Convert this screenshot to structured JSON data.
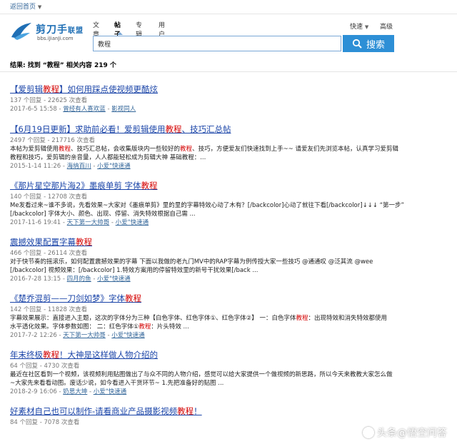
{
  "topbar": {
    "back_link": "返回首页"
  },
  "logo": {
    "name": "剪刀手",
    "brand": "联盟",
    "domain": "bbs.iJianJi.com"
  },
  "tabs": [
    "文章",
    "帖子",
    "专辑",
    "用户"
  ],
  "right_links": {
    "quick": "快速",
    "advanced": "高级"
  },
  "search": {
    "value": "教程",
    "button": "搜索"
  },
  "summary": {
    "prefix": "结果: 找到 “",
    "keyword": "教程",
    "suffix": "” 相关内容 219 个"
  },
  "results": [
    {
      "title_a": "【爱剪辑",
      "title_hl": "教程",
      "title_b": "】如何用踩点使视频更酷炫",
      "meta": "137 个回复 - 22625 次查看",
      "summary_html": "",
      "info_date": "2017-6-5 15:58",
      "info_author": "曾经有人喜欢蓝",
      "info_forum": "影视同人"
    },
    {
      "title_a": "【6月19日更新】求助前必看！爱剪辑使用",
      "title_hl": "教程",
      "title_b": "、技巧汇总帖",
      "meta": "2497 个回复 - 217716 次查看",
      "summary_a": "本帖为爱剪辑使用",
      "summary_hl1": "教程",
      "summary_b": "、技巧汇总帖，会收集版块内一些较好的",
      "summary_hl2": "教程",
      "summary_c": "、技巧，方便爱友们快速找到上手~~ 请爱友们先浏览本帖，认真学习爱剪辑",
      "summary_line2": "教程和技巧，爱剪辑的亲音量，人人都能轻松成为剪辑大神 基础教程：...",
      "info_date": "2015-1-14 11:26",
      "info_author": "海纳百川",
      "info_forum": "小爱\"快速通"
    },
    {
      "title_a": "《那片星空那片海2》墨痕单剪 字体",
      "title_hl": "教程",
      "title_b": "",
      "meta": "140 个回复 - 12708 次查看",
      "summary_a": "Me发看过来~谁不多说，先看效果~大家对《墨痕单剪》里的里的字幕特效心动了木有？[/backcolor]心动了就往下看[/backcolor]↓↓↓ “第一步”",
      "summary_line2": "[/backcolor] 字体大小、颜色、出现、停留、消失特效根据自己需 ...",
      "info_date": "2017-11-6 19:41",
      "info_author": "天下第一大帅哥",
      "info_forum": "小爱\"快速通"
    },
    {
      "title_a": "震撼效果配置字幕",
      "title_hl": "教程",
      "title_b": "",
      "meta": "466 个回复 - 26114 次查看",
      "summary_a": "对于快节奏的摇滚乐，如何配置震撼效果的字幕 下面以我做的老九门MV中的RAP字幕为例传授大家一些技巧 @通通叹 @泛其流 @wee",
      "summary_line2": "[/backcolor] 视频效果：[/backcolor] 1.特效方案用的停留特效里的新号干扰效果[/back ...",
      "info_date": "2016-7-28 13:15",
      "info_author": "四月的鱼",
      "info_forum": "小爱\"快速通"
    },
    {
      "title_a": "《楚乔混剪——刀剑如梦》字体",
      "title_hl": "教程",
      "title_b": "",
      "meta": "142 个回复 - 11828 次查看",
      "summary_a": "字幕效果展示：直接进入主题，这次的字体分为三种【白色字体、红色字体①、红色字体②】 一：白色字体",
      "summary_hl1": "教程",
      "summary_b": "：出现特效和消失特效都使用",
      "summary_line2": "水平透化效果。字体参数如图： 二：红色字体①",
      "summary_hl3": "教程",
      "summary_line2b": "：片头特效 ...",
      "info_date": "2017-7-2 12:26",
      "info_author": "天下第一大帅哥",
      "info_forum": "小爱\"快速通"
    },
    {
      "title_a": "年末终极",
      "title_hl": "教程",
      "title_b": "！大神是这样做人物介绍的",
      "meta": "64 个回复 - 4730 次查看",
      "summary_a": "最近在社区看到一个视频，该视频利用贴图做出了与众不同的人物介绍，感觉可以给大家提供一个做视频的新思路，所以今天来教教大家怎么做",
      "summary_line2": "~大家先来看看动图。废话少说，如今看进入干货环节~ 1.先把准备好的贴图 ...",
      "info_date": "2018-2-9 16:06",
      "info_author": "奶思大坤",
      "info_forum": "小爱\"快速通"
    },
    {
      "title_a": "好素材自己也可以制作-请看商业产品摄影视频",
      "title_hl": "教程",
      "title_b": "！",
      "meta": "84 个回复 - 7078 次查看",
      "summary_a": "",
      "summary_line2": "",
      "info_date": "",
      "info_author": "",
      "info_forum": ""
    }
  ],
  "watermark": "头条@悟空问答",
  "colors": {
    "link": "#1a44a8",
    "highlight": "#d40000",
    "accent": "#2d8fd6"
  }
}
